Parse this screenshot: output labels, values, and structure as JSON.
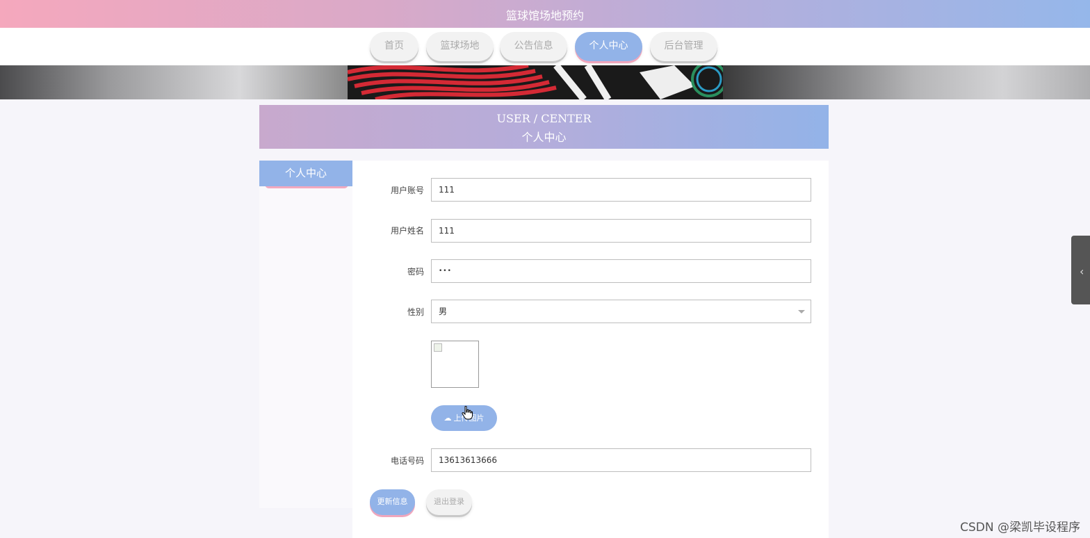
{
  "header": {
    "site_title": "篮球馆场地预约"
  },
  "nav": {
    "items": [
      {
        "label": "首页"
      },
      {
        "label": "篮球场地"
      },
      {
        "label": "公告信息"
      },
      {
        "label": "个人中心",
        "active": true
      },
      {
        "label": "后台管理"
      }
    ]
  },
  "section": {
    "title_en": "USER / CENTER",
    "title_zh": "个人中心"
  },
  "sidebar": {
    "items": [
      {
        "label": "个人中心",
        "active": true
      }
    ]
  },
  "form": {
    "account": {
      "label": "用户账号",
      "value": "111"
    },
    "name": {
      "label": "用户姓名",
      "value": "111"
    },
    "password": {
      "label": "密码",
      "value": "•••"
    },
    "gender": {
      "label": "性别",
      "value": "男"
    },
    "upload_label": "上传图片",
    "phone": {
      "label": "电话号码",
      "value": "13613613666"
    }
  },
  "actions": {
    "update_label": "更新信息",
    "logout_label": "退出登录"
  },
  "watermark": "CSDN @梁凯毕设程序",
  "colors": {
    "accent_blue": "#92b3e8",
    "accent_pink": "#f0a6bc"
  }
}
